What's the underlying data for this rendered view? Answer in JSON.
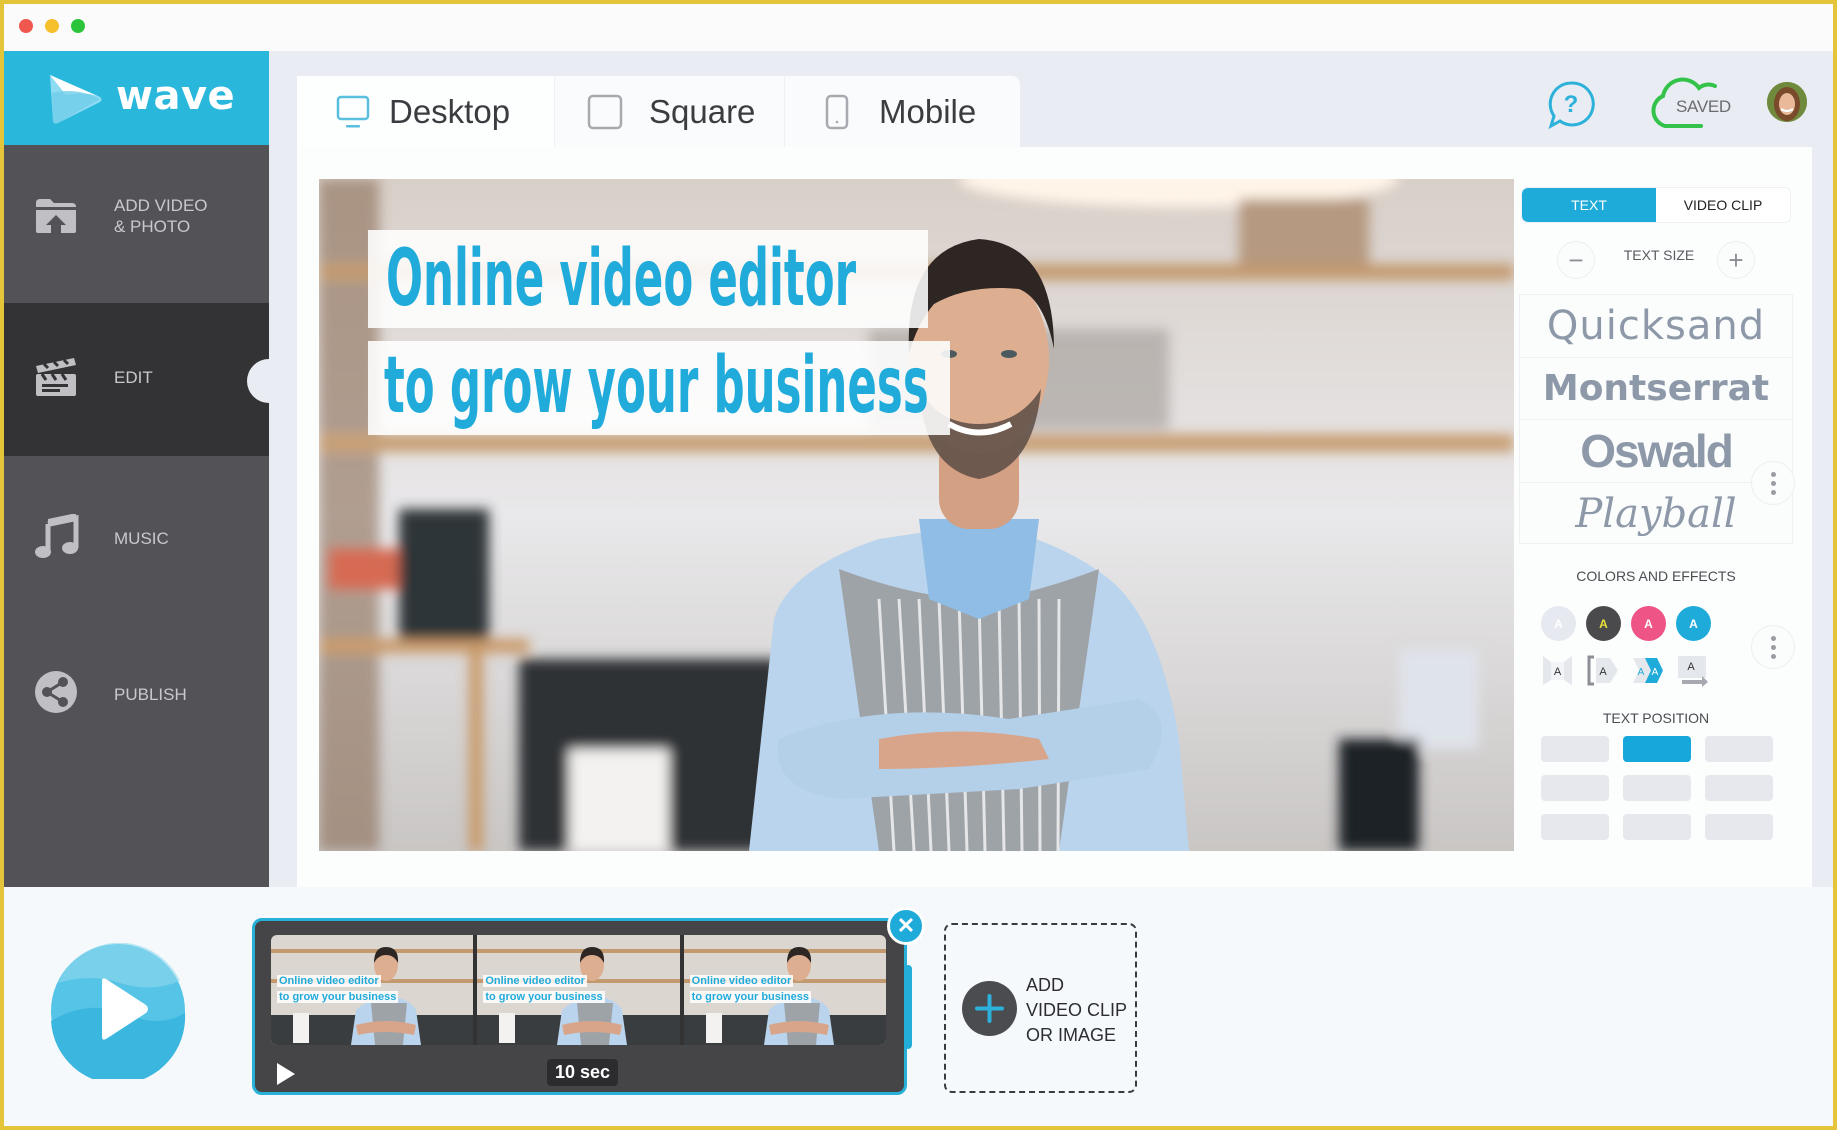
{
  "window": {
    "traffic_lights": [
      "close",
      "minimize",
      "maximize"
    ]
  },
  "brand": {
    "name": "wave",
    "icon": "play-triangle-logo-icon",
    "color": "#29b7dc"
  },
  "sidebar": {
    "items": [
      {
        "label_line1": "ADD VIDEO",
        "label_line2": "& PHOTO",
        "icon": "folder-upload-icon",
        "active": false
      },
      {
        "label_line1": "EDIT",
        "label_line2": "",
        "icon": "clapperboard-icon",
        "active": true
      },
      {
        "label_line1": "MUSIC",
        "label_line2": "",
        "icon": "music-note-icon",
        "active": false
      },
      {
        "label_line1": "PUBLISH",
        "label_line2": "",
        "icon": "share-icon",
        "active": false
      }
    ]
  },
  "format_tabs": [
    {
      "label": "Desktop",
      "icon": "monitor-icon",
      "active": true
    },
    {
      "label": "Square",
      "icon": "square-icon",
      "active": false
    },
    {
      "label": "Mobile",
      "icon": "phone-icon",
      "active": false
    }
  ],
  "header": {
    "help_icon": "help-chat-icon",
    "save_status": "SAVED",
    "save_icon": "cloud-icon",
    "avatar": "user-avatar"
  },
  "preview": {
    "title_line1": "Online video editor",
    "title_line2": "to grow your business",
    "title_color": "#21abdb"
  },
  "right_panel": {
    "tabs": [
      {
        "label": "TEXT",
        "active": true
      },
      {
        "label": "VIDEO CLIP",
        "active": false
      }
    ],
    "text_size_label": "TEXT SIZE",
    "decrease_symbol": "−",
    "increase_symbol": "+",
    "fonts": [
      "Quicksand",
      "Montserrat",
      "Oswald",
      "Playball"
    ],
    "colors_label": "COLORS AND EFFECTS",
    "color_swatches": [
      {
        "letter": "A",
        "bg": "#e6e9ef",
        "fg": "#ffffff"
      },
      {
        "letter": "A",
        "bg": "#4a4a4c",
        "fg": "#e8e23a"
      },
      {
        "letter": "A",
        "bg": "#ee5486",
        "fg": "#ffffff"
      },
      {
        "letter": "A",
        "bg": "#1fabda",
        "fg": "#ffffff"
      }
    ],
    "effects": [
      {
        "letter": "A",
        "name": "effect-fold"
      },
      {
        "letter": "A",
        "name": "effect-bracket-arrow"
      },
      {
        "letter": "A",
        "name": "effect-chevron-double"
      },
      {
        "letter": "A",
        "name": "effect-slide-arrow"
      }
    ],
    "position_label": "TEXT POSITION",
    "positions": [
      [
        false,
        true,
        false
      ],
      [
        false,
        false,
        false
      ],
      [
        false,
        false,
        false
      ]
    ]
  },
  "timeline": {
    "clip_duration": "10 sec",
    "thumb_text_line1": "Online video editor",
    "thumb_text_line2": "to grow your business",
    "thumb_count": 3,
    "add_label_line1": "ADD",
    "add_label_line2": "VIDEO CLIP",
    "add_label_line3": "OR IMAGE"
  }
}
